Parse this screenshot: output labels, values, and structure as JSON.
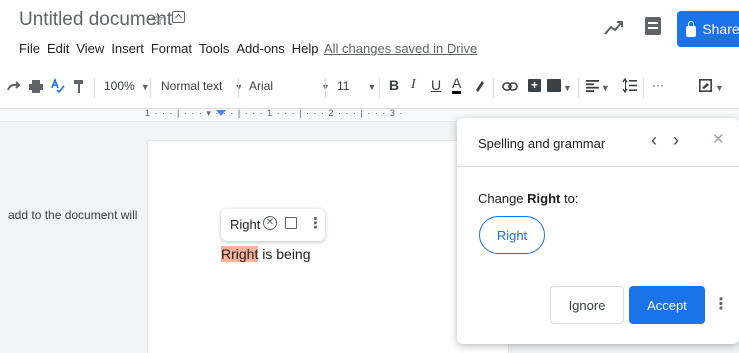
{
  "header": {
    "doc_title": "Untitled document",
    "star_glyph": "☆",
    "menu": [
      "File",
      "Edit",
      "View",
      "Insert",
      "Format",
      "Tools",
      "Add-ons",
      "Help"
    ],
    "saved_status": "All changes saved in Drive",
    "share_label": "Share"
  },
  "toolbar": {
    "zoom": "100%",
    "style": "Normal text",
    "font": "Arial",
    "font_size": "11",
    "bold": "B",
    "italic": "I",
    "underline": "U",
    "text_color": "A",
    "more": "···"
  },
  "ruler": {
    "text": "1 · · · | · · · ▾ · · · | · · · 1 · · · | · · · 2 · · · | · · · 3 ·"
  },
  "document": {
    "side_text": "add to the document will",
    "misspelled_word": "Rright",
    "line_rest": " is being"
  },
  "suggestion_popup": {
    "word": "Right"
  },
  "panel": {
    "title": "Spelling and grammar",
    "change_prefix": "Change ",
    "change_word": "Right",
    "change_suffix": " to:",
    "suggestion": "Right",
    "ignore_label": "Ignore",
    "accept_label": "Accept"
  },
  "colors": {
    "accent": "#1a73e8",
    "misspelling_highlight": "#f6b39a"
  }
}
